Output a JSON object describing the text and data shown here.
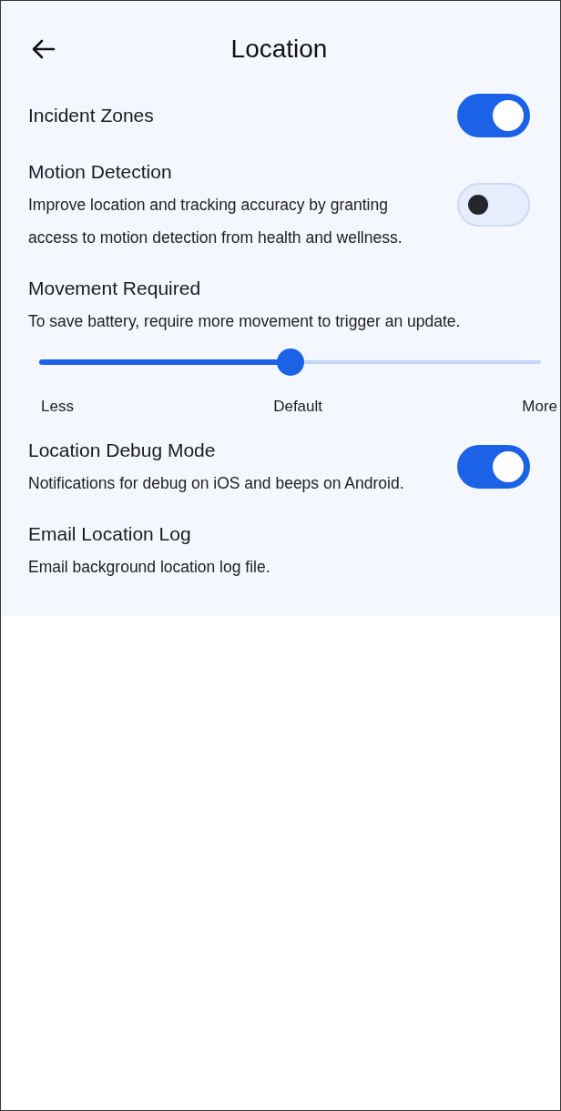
{
  "header": {
    "title": "Location"
  },
  "settings": [
    {
      "kind": "toggle",
      "title": "Incident Zones",
      "on": true
    },
    {
      "kind": "toggle",
      "title": "Motion Detection",
      "description": "Improve location and tracking accuracy by granting access to motion detection from health and wellness.",
      "on": false
    },
    {
      "kind": "slider",
      "title": "Movement Required",
      "description": "To save battery, require more movement to trigger an update.",
      "level": 0.5,
      "labels": [
        "Less",
        "Default",
        "More"
      ]
    },
    {
      "kind": "toggle",
      "title": "Location Debug Mode",
      "description": "Notifications for debug on iOS and beeps on Android.",
      "on": true
    },
    {
      "kind": "action",
      "title": "Email Location Log",
      "description": "Email background location log file."
    }
  ]
}
